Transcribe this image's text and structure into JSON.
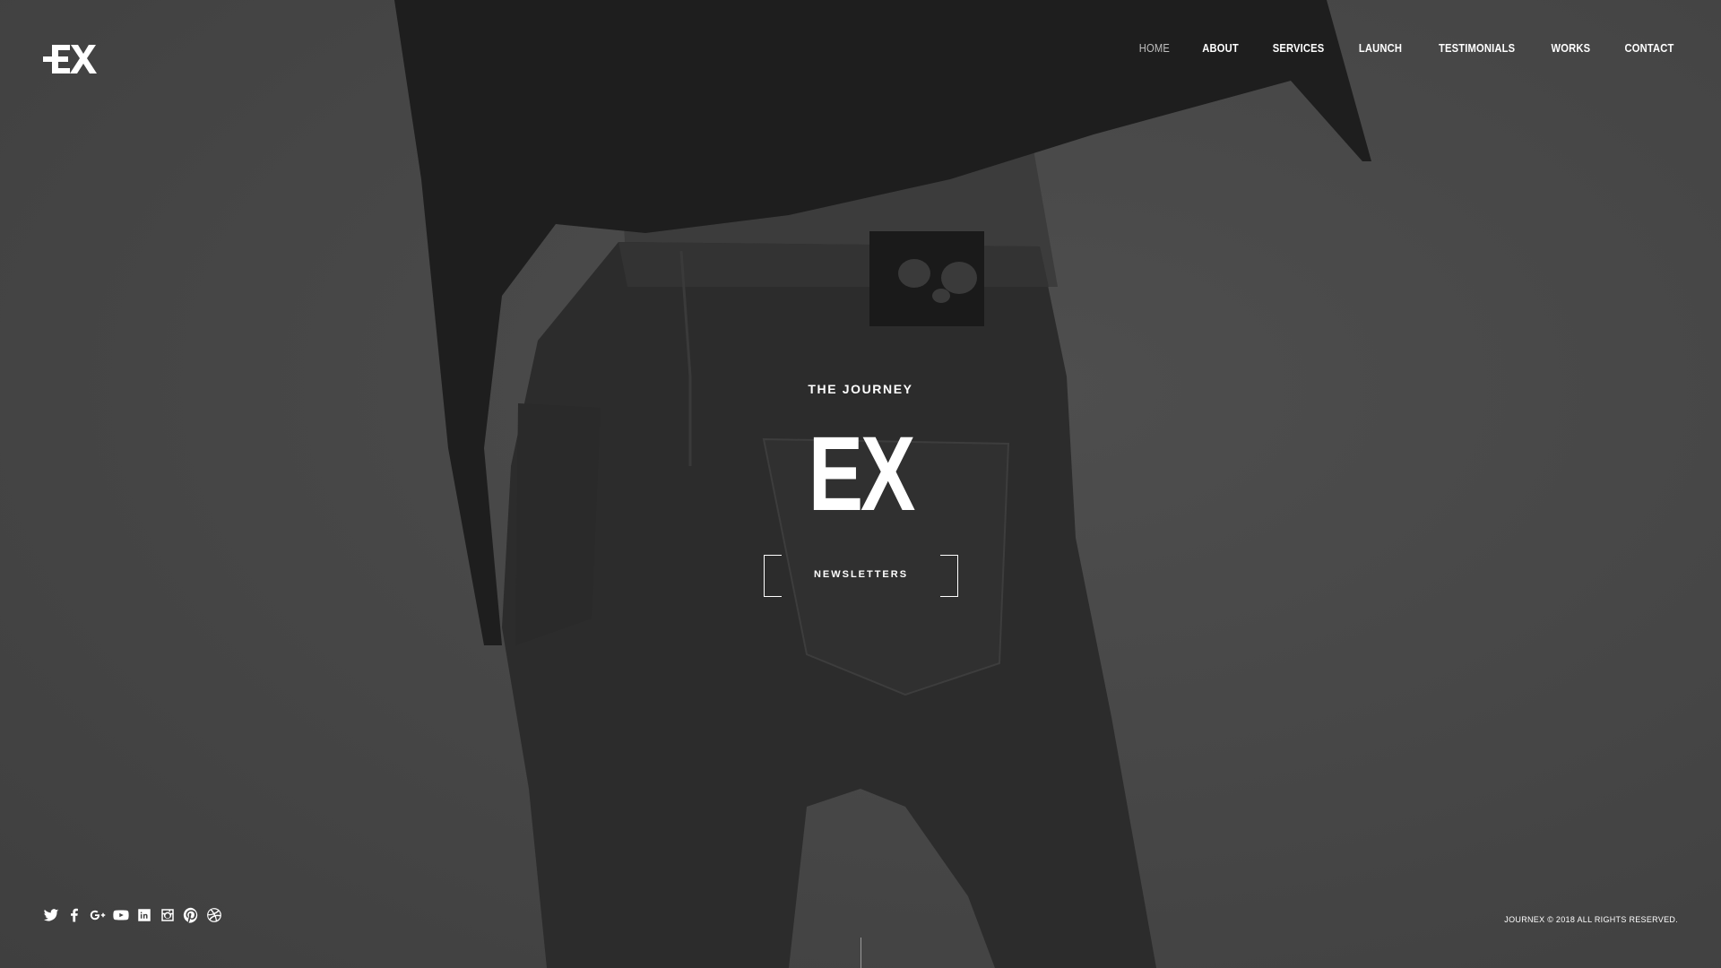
{
  "header": {
    "logo_text": "EX",
    "nav": [
      {
        "label": "HOME",
        "active": true
      },
      {
        "label": "ABOUT",
        "active": false
      },
      {
        "label": "SERVICES",
        "active": false
      },
      {
        "label": "LAUNCH",
        "active": false
      },
      {
        "label": "TESTIMONIALS",
        "active": false
      },
      {
        "label": "WORKS",
        "active": false
      },
      {
        "label": "CONTACT",
        "active": false
      }
    ]
  },
  "hero": {
    "eyebrow": "THE JOURNEY",
    "title": "EX",
    "button_label": "NEWSLETTERS"
  },
  "footer": {
    "social_icons": [
      "twitter-icon",
      "facebook-icon",
      "google-plus-icon",
      "youtube-icon",
      "linkedin-icon",
      "instagram-icon",
      "pinterest-icon",
      "dribbble-icon"
    ],
    "copyright": "JOURNEX © 2018 ALL RIGHTS RESERVED."
  },
  "colors": {
    "background": "#474747",
    "text": "#ffffff",
    "nav_active": "#bfbfbf"
  }
}
